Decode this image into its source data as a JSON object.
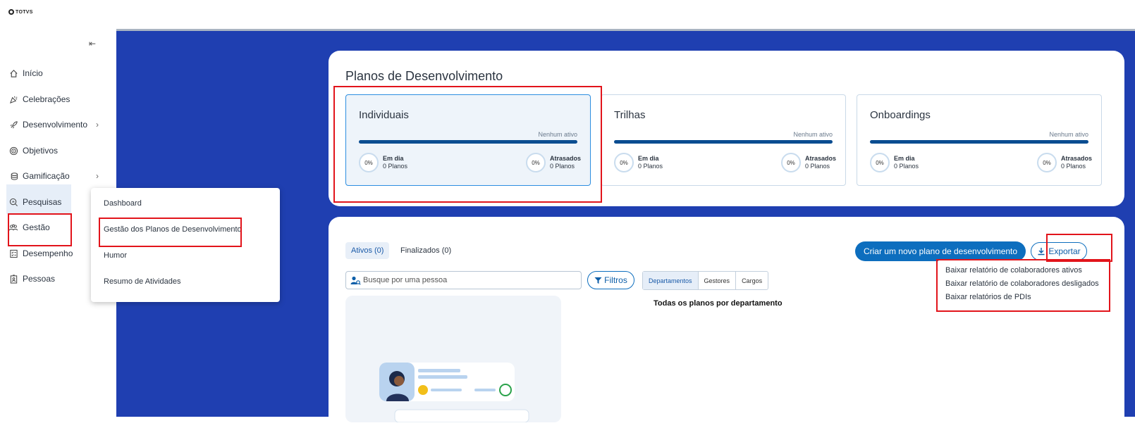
{
  "app": {
    "logo_text": "TOTVS"
  },
  "sidebar": {
    "items": [
      {
        "label": "Início",
        "icon": "home-icon"
      },
      {
        "label": "Celebrações",
        "icon": "party-icon"
      },
      {
        "label": "Desenvolvimento",
        "icon": "rocket-icon",
        "has_submenu": true
      },
      {
        "label": "Objetivos",
        "icon": "target-icon"
      },
      {
        "label": "Gamificação",
        "icon": "coins-icon",
        "has_submenu": true
      },
      {
        "label": "Pesquisas",
        "icon": "search-chart-icon"
      },
      {
        "label": "Gestão",
        "icon": "people-icon",
        "active": true
      },
      {
        "label": "Desempenho",
        "icon": "checklist-icon"
      },
      {
        "label": "Pessoas",
        "icon": "id-badge-icon"
      }
    ]
  },
  "gestao_menu": {
    "items": [
      "Dashboard",
      "Gestão dos Planos de Desenvolvimento",
      "Humor",
      "Resumo de Atividades"
    ]
  },
  "summary": {
    "title": "Planos de Desenvolvimento",
    "cards": [
      {
        "title": "Individuais",
        "status": "Nenhum ativo",
        "on_time_label": "Em dia",
        "on_time_pct": "0%",
        "on_time_count": "0 Planos",
        "late_label": "Atrasados",
        "late_pct": "0%",
        "late_count": "0 Planos"
      },
      {
        "title": "Trilhas",
        "status": "Nenhum ativo",
        "on_time_label": "Em dia",
        "on_time_pct": "0%",
        "on_time_count": "0 Planos",
        "late_label": "Atrasados",
        "late_pct": "0%",
        "late_count": "0 Planos"
      },
      {
        "title": "Onboardings",
        "status": "Nenhum ativo",
        "on_time_label": "Em dia",
        "on_time_pct": "0%",
        "on_time_count": "0 Planos",
        "late_label": "Atrasados",
        "late_pct": "0%",
        "late_count": "0 Planos"
      }
    ]
  },
  "list": {
    "tabs": [
      "Ativos (0)",
      "Finalizados (0)"
    ],
    "create_button": "Criar um novo plano de desenvolvimento",
    "export_button": "Exportar",
    "search_placeholder": "Busque por uma pessoa",
    "filters_button": "Filtros",
    "segments": [
      "Departamentos",
      "Gestores",
      "Cargos"
    ],
    "chart_title": "Todas os planos por departamento",
    "export_menu": [
      "Baixar relatório de colaboradores ativos",
      "Baixar relatório de colaboradores desligados",
      "Baixar relatórios de PDIs"
    ]
  },
  "colors": {
    "brand_blue": "#1f3fb1",
    "primary": "#0d6ebe",
    "highlight_red": "#e2141b"
  }
}
